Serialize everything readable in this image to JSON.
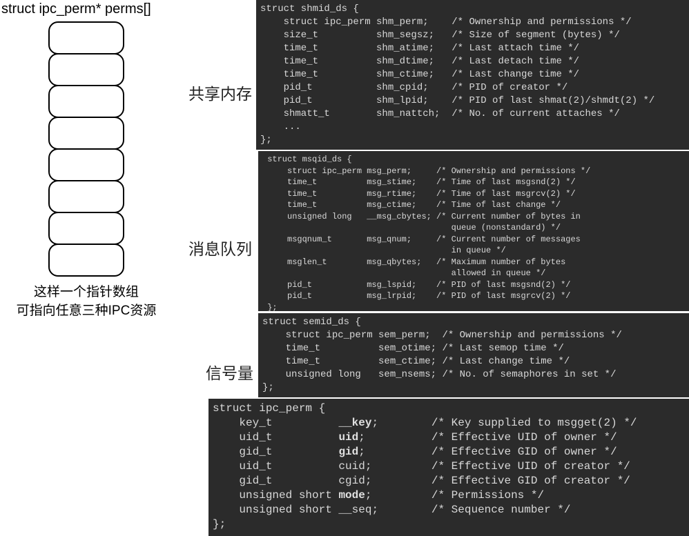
{
  "left": {
    "title": "struct ipc_perm* perms[]",
    "caption_line1": "这样一个指针数组",
    "caption_line2": "可指向任意三种IPC资源",
    "cell_count": 8
  },
  "labels": {
    "shm": "共享内存",
    "msq": "消息队列",
    "sem": "信号量"
  },
  "code": {
    "shm": "struct shmid_ds {\n    struct ipc_perm shm_perm;    /* Ownership and permissions */\n    size_t          shm_segsz;   /* Size of segment (bytes) */\n    time_t          shm_atime;   /* Last attach time */\n    time_t          shm_dtime;   /* Last detach time */\n    time_t          shm_ctime;   /* Last change time */\n    pid_t           shm_cpid;    /* PID of creator */\n    pid_t           shm_lpid;    /* PID of last shmat(2)/shmdt(2) */\n    shmatt_t        shm_nattch;  /* No. of current attaches */\n    ...\n};",
    "msq": " struct msqid_ds {\n     struct ipc_perm msg_perm;     /* Ownership and permissions */\n     time_t          msg_stime;    /* Time of last msgsnd(2) */\n     time_t          msg_rtime;    /* Time of last msgrcv(2) */\n     time_t          msg_ctime;    /* Time of last change */\n     unsigned long   __msg_cbytes; /* Current number of bytes in\n                                      queue (nonstandard) */\n     msgqnum_t       msg_qnum;     /* Current number of messages\n                                      in queue */\n     msglen_t        msg_qbytes;   /* Maximum number of bytes\n                                      allowed in queue */\n     pid_t           msg_lspid;    /* PID of last msgsnd(2) */\n     pid_t           msg_lrpid;    /* PID of last msgrcv(2) */\n };",
    "sem": "struct semid_ds {\n    struct ipc_perm sem_perm;  /* Ownership and permissions */\n    time_t          sem_otime; /* Last semop time */\n    time_t          sem_ctime; /* Last change time */\n    unsigned long   sem_nsems; /* No. of semaphores in set */\n};",
    "ipc_head": "struct ipc_perm {",
    "ipc_l1a": "    key_t          ",
    "ipc_l1b": "__key",
    "ipc_l1c": ";        /* Key supplied to msgget(2) */",
    "ipc_l2a": "    uid_t          ",
    "ipc_l2b": "uid",
    "ipc_l2c": ";          /* Effective UID of owner */",
    "ipc_l3a": "    gid_t          ",
    "ipc_l3b": "gid",
    "ipc_l3c": ";          /* Effective GID of owner */",
    "ipc_l4a": "    uid_t          cuid;         /* Effective UID of creator */",
    "ipc_l5a": "    gid_t          cgid;         /* Effective GID of creator */",
    "ipc_l6a": "    unsigned short ",
    "ipc_l6b": "mode",
    "ipc_l6c": ";         /* Permissions */",
    "ipc_l7a": "    unsigned short __seq;        /* Sequence number */",
    "ipc_tail": "};"
  }
}
